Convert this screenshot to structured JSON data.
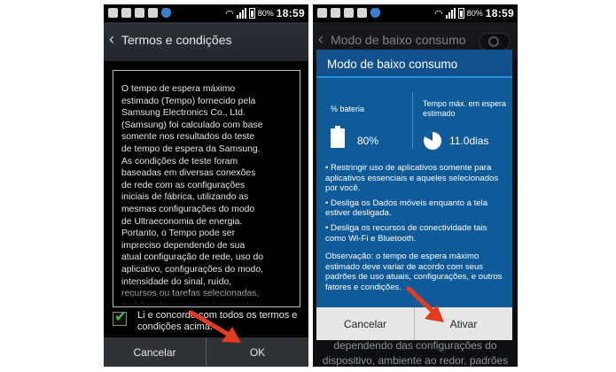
{
  "screen1": {
    "status": {
      "battery": "80%",
      "time": "18:59"
    },
    "title": "Termos e condições",
    "terms": "O tempo de espera máximo\nestimado (Tempo) fornecido pela\nSamsung Electronics Co., Ltd.\n(Samsung) foi calculado com base\nsomente nos resultados do teste\nde tempo de espera da Samsung.\nAs condições de teste foram\nbaseadas em diversas conexões\nde rede com as configurações\niniciais de fábrica, utilizando as\nmesmas configurações do modo\nde Ultraeconomia de energia.\nPortanto, o Tempo pode ser\nimpreciso dependendo de sua\natual configuração de rede, uso do\naplicativo, configurações do modo,\nintensidade do sinal, ruído,\nrecursos ou tarefas selecionadas,\npadrões de uso reais, temperatura\noperacional e outros fatores e",
    "agree": "Li e concordo com todos os termos e condições acima.",
    "cancel": "Cancelar",
    "ok": "OK"
  },
  "screen2": {
    "status": {
      "battery": "80%",
      "time": "18:59"
    },
    "title": "Modo de baixo consumo",
    "dialog": {
      "title": "Modo de baixo consumo",
      "battery_label": "% bateria",
      "battery_value": "80%",
      "time_label": "Tempo máx. em espera estimado",
      "time_value": "11.0dias",
      "bullets": [
        "• Restringir uso de aplicativos somente para aplicativos essenciais e aqueles selecionados por você.",
        "• Desliga os Dados móveis enquanto a tela estiver desligada.",
        "• Desliga os recursos de conectividade tais como Wi-Fi e Bluetooth."
      ],
      "note": "Observação: o tempo de espera máximo estimado deve variar de acordo com seus padrões de uso atuais, configurações, e outros fatores e condições.",
      "cancel": "Cancelar",
      "activate": "Ativar"
    },
    "behind_text": "dependendo das configurações do dispositivo, ambiente ao redor, padrões"
  },
  "colors": {
    "dialog_blue": "#0f5a99",
    "accent_blue": "#2b8fe0",
    "arrow_red": "#e53b1f",
    "check_green": "#4caf50"
  }
}
